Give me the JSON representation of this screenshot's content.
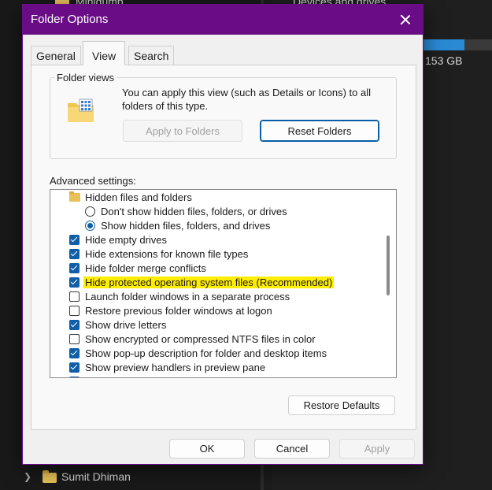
{
  "background": {
    "top_folder": "Minidump",
    "right_header": "Devices and drives",
    "drive_size": "153 GB",
    "bottom_folder": "Sumit Dhiman"
  },
  "dialog": {
    "title": "Folder Options",
    "tabs": [
      {
        "label": "General",
        "active": false
      },
      {
        "label": "View",
        "active": true
      },
      {
        "label": "Search",
        "active": false
      }
    ],
    "folder_views": {
      "label": "Folder views",
      "description": "You can apply this view (such as Details or Icons) to all folders of this type.",
      "apply_button": "Apply to Folders",
      "reset_button": "Reset Folders"
    },
    "advanced": {
      "label": "Advanced settings:",
      "items": [
        {
          "type": "folder",
          "label": "Hidden files and folders",
          "indent": 0
        },
        {
          "type": "radio",
          "checked": false,
          "label": "Don't show hidden files, folders, or drives",
          "indent": 1
        },
        {
          "type": "radio",
          "checked": true,
          "label": "Show hidden files, folders, and drives",
          "indent": 1
        },
        {
          "type": "checkbox",
          "checked": true,
          "label": "Hide empty drives",
          "indent": 0
        },
        {
          "type": "checkbox",
          "checked": true,
          "label": "Hide extensions for known file types",
          "indent": 0
        },
        {
          "type": "checkbox",
          "checked": true,
          "label": "Hide folder merge conflicts",
          "indent": 0
        },
        {
          "type": "checkbox",
          "checked": true,
          "label": "Hide protected operating system files (Recommended)",
          "indent": 0,
          "highlighted": true
        },
        {
          "type": "checkbox",
          "checked": false,
          "label": "Launch folder windows in a separate process",
          "indent": 0
        },
        {
          "type": "checkbox",
          "checked": false,
          "label": "Restore previous folder windows at logon",
          "indent": 0
        },
        {
          "type": "checkbox",
          "checked": true,
          "label": "Show drive letters",
          "indent": 0
        },
        {
          "type": "checkbox",
          "checked": false,
          "label": "Show encrypted or compressed NTFS files in color",
          "indent": 0
        },
        {
          "type": "checkbox",
          "checked": true,
          "label": "Show pop-up description for folder and desktop items",
          "indent": 0
        },
        {
          "type": "checkbox",
          "checked": true,
          "label": "Show preview handlers in preview pane",
          "indent": 0
        }
      ],
      "restore_button": "Restore Defaults"
    },
    "footer": {
      "ok": "OK",
      "cancel": "Cancel",
      "apply": "Apply"
    },
    "colors": {
      "titlebar": "#690c85",
      "checkbox": "#0f5ea8",
      "highlight": "#ffee00"
    }
  }
}
